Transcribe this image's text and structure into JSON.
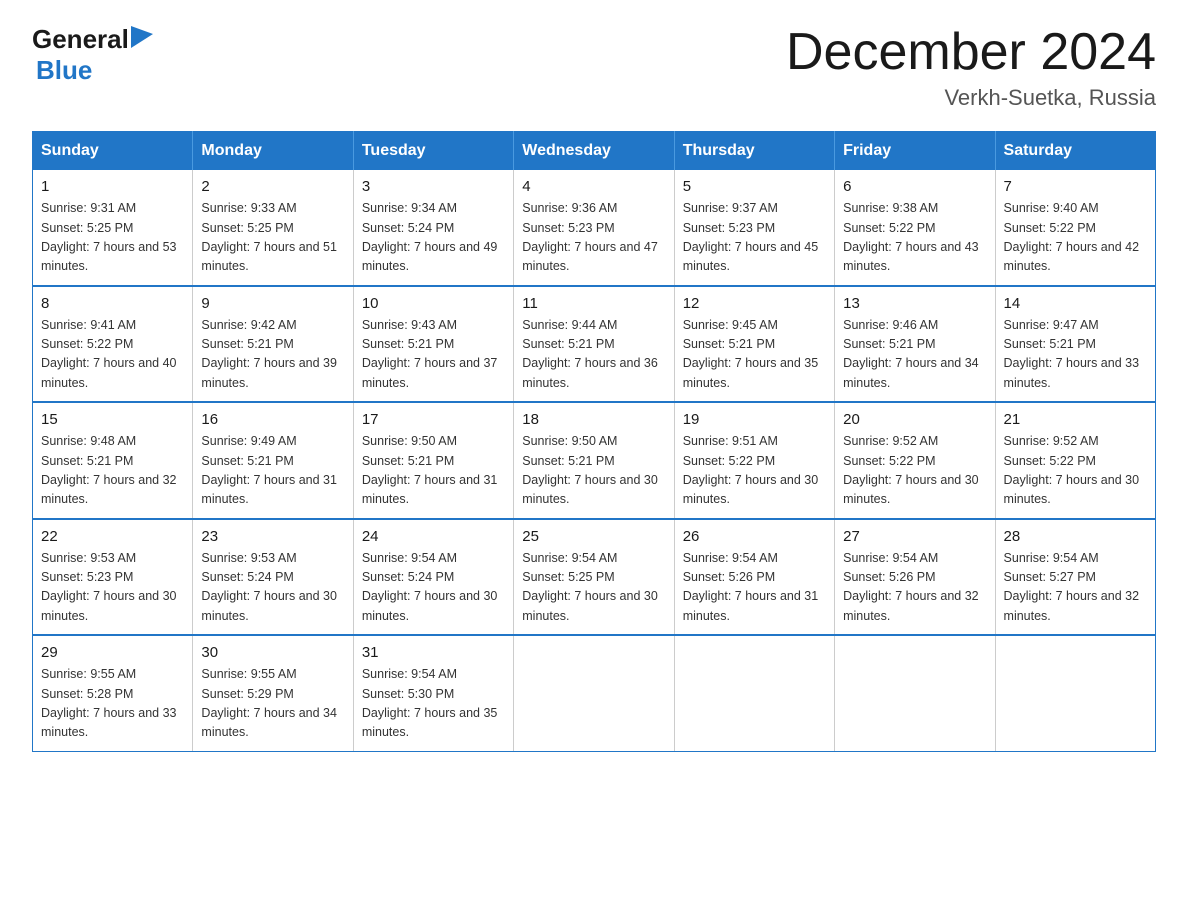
{
  "header": {
    "logo_general": "General",
    "logo_blue": "Blue",
    "month_title": "December 2024",
    "location": "Verkh-Suetka, Russia"
  },
  "days_of_week": [
    "Sunday",
    "Monday",
    "Tuesday",
    "Wednesday",
    "Thursday",
    "Friday",
    "Saturday"
  ],
  "weeks": [
    [
      {
        "day": "1",
        "sunrise": "9:31 AM",
        "sunset": "5:25 PM",
        "daylight": "7 hours and 53 minutes."
      },
      {
        "day": "2",
        "sunrise": "9:33 AM",
        "sunset": "5:25 PM",
        "daylight": "7 hours and 51 minutes."
      },
      {
        "day": "3",
        "sunrise": "9:34 AM",
        "sunset": "5:24 PM",
        "daylight": "7 hours and 49 minutes."
      },
      {
        "day": "4",
        "sunrise": "9:36 AM",
        "sunset": "5:23 PM",
        "daylight": "7 hours and 47 minutes."
      },
      {
        "day": "5",
        "sunrise": "9:37 AM",
        "sunset": "5:23 PM",
        "daylight": "7 hours and 45 minutes."
      },
      {
        "day": "6",
        "sunrise": "9:38 AM",
        "sunset": "5:22 PM",
        "daylight": "7 hours and 43 minutes."
      },
      {
        "day": "7",
        "sunrise": "9:40 AM",
        "sunset": "5:22 PM",
        "daylight": "7 hours and 42 minutes."
      }
    ],
    [
      {
        "day": "8",
        "sunrise": "9:41 AM",
        "sunset": "5:22 PM",
        "daylight": "7 hours and 40 minutes."
      },
      {
        "day": "9",
        "sunrise": "9:42 AM",
        "sunset": "5:21 PM",
        "daylight": "7 hours and 39 minutes."
      },
      {
        "day": "10",
        "sunrise": "9:43 AM",
        "sunset": "5:21 PM",
        "daylight": "7 hours and 37 minutes."
      },
      {
        "day": "11",
        "sunrise": "9:44 AM",
        "sunset": "5:21 PM",
        "daylight": "7 hours and 36 minutes."
      },
      {
        "day": "12",
        "sunrise": "9:45 AM",
        "sunset": "5:21 PM",
        "daylight": "7 hours and 35 minutes."
      },
      {
        "day": "13",
        "sunrise": "9:46 AM",
        "sunset": "5:21 PM",
        "daylight": "7 hours and 34 minutes."
      },
      {
        "day": "14",
        "sunrise": "9:47 AM",
        "sunset": "5:21 PM",
        "daylight": "7 hours and 33 minutes."
      }
    ],
    [
      {
        "day": "15",
        "sunrise": "9:48 AM",
        "sunset": "5:21 PM",
        "daylight": "7 hours and 32 minutes."
      },
      {
        "day": "16",
        "sunrise": "9:49 AM",
        "sunset": "5:21 PM",
        "daylight": "7 hours and 31 minutes."
      },
      {
        "day": "17",
        "sunrise": "9:50 AM",
        "sunset": "5:21 PM",
        "daylight": "7 hours and 31 minutes."
      },
      {
        "day": "18",
        "sunrise": "9:50 AM",
        "sunset": "5:21 PM",
        "daylight": "7 hours and 30 minutes."
      },
      {
        "day": "19",
        "sunrise": "9:51 AM",
        "sunset": "5:22 PM",
        "daylight": "7 hours and 30 minutes."
      },
      {
        "day": "20",
        "sunrise": "9:52 AM",
        "sunset": "5:22 PM",
        "daylight": "7 hours and 30 minutes."
      },
      {
        "day": "21",
        "sunrise": "9:52 AM",
        "sunset": "5:22 PM",
        "daylight": "7 hours and 30 minutes."
      }
    ],
    [
      {
        "day": "22",
        "sunrise": "9:53 AM",
        "sunset": "5:23 PM",
        "daylight": "7 hours and 30 minutes."
      },
      {
        "day": "23",
        "sunrise": "9:53 AM",
        "sunset": "5:24 PM",
        "daylight": "7 hours and 30 minutes."
      },
      {
        "day": "24",
        "sunrise": "9:54 AM",
        "sunset": "5:24 PM",
        "daylight": "7 hours and 30 minutes."
      },
      {
        "day": "25",
        "sunrise": "9:54 AM",
        "sunset": "5:25 PM",
        "daylight": "7 hours and 30 minutes."
      },
      {
        "day": "26",
        "sunrise": "9:54 AM",
        "sunset": "5:26 PM",
        "daylight": "7 hours and 31 minutes."
      },
      {
        "day": "27",
        "sunrise": "9:54 AM",
        "sunset": "5:26 PM",
        "daylight": "7 hours and 32 minutes."
      },
      {
        "day": "28",
        "sunrise": "9:54 AM",
        "sunset": "5:27 PM",
        "daylight": "7 hours and 32 minutes."
      }
    ],
    [
      {
        "day": "29",
        "sunrise": "9:55 AM",
        "sunset": "5:28 PM",
        "daylight": "7 hours and 33 minutes."
      },
      {
        "day": "30",
        "sunrise": "9:55 AM",
        "sunset": "5:29 PM",
        "daylight": "7 hours and 34 minutes."
      },
      {
        "day": "31",
        "sunrise": "9:54 AM",
        "sunset": "5:30 PM",
        "daylight": "7 hours and 35 minutes."
      },
      null,
      null,
      null,
      null
    ]
  ]
}
